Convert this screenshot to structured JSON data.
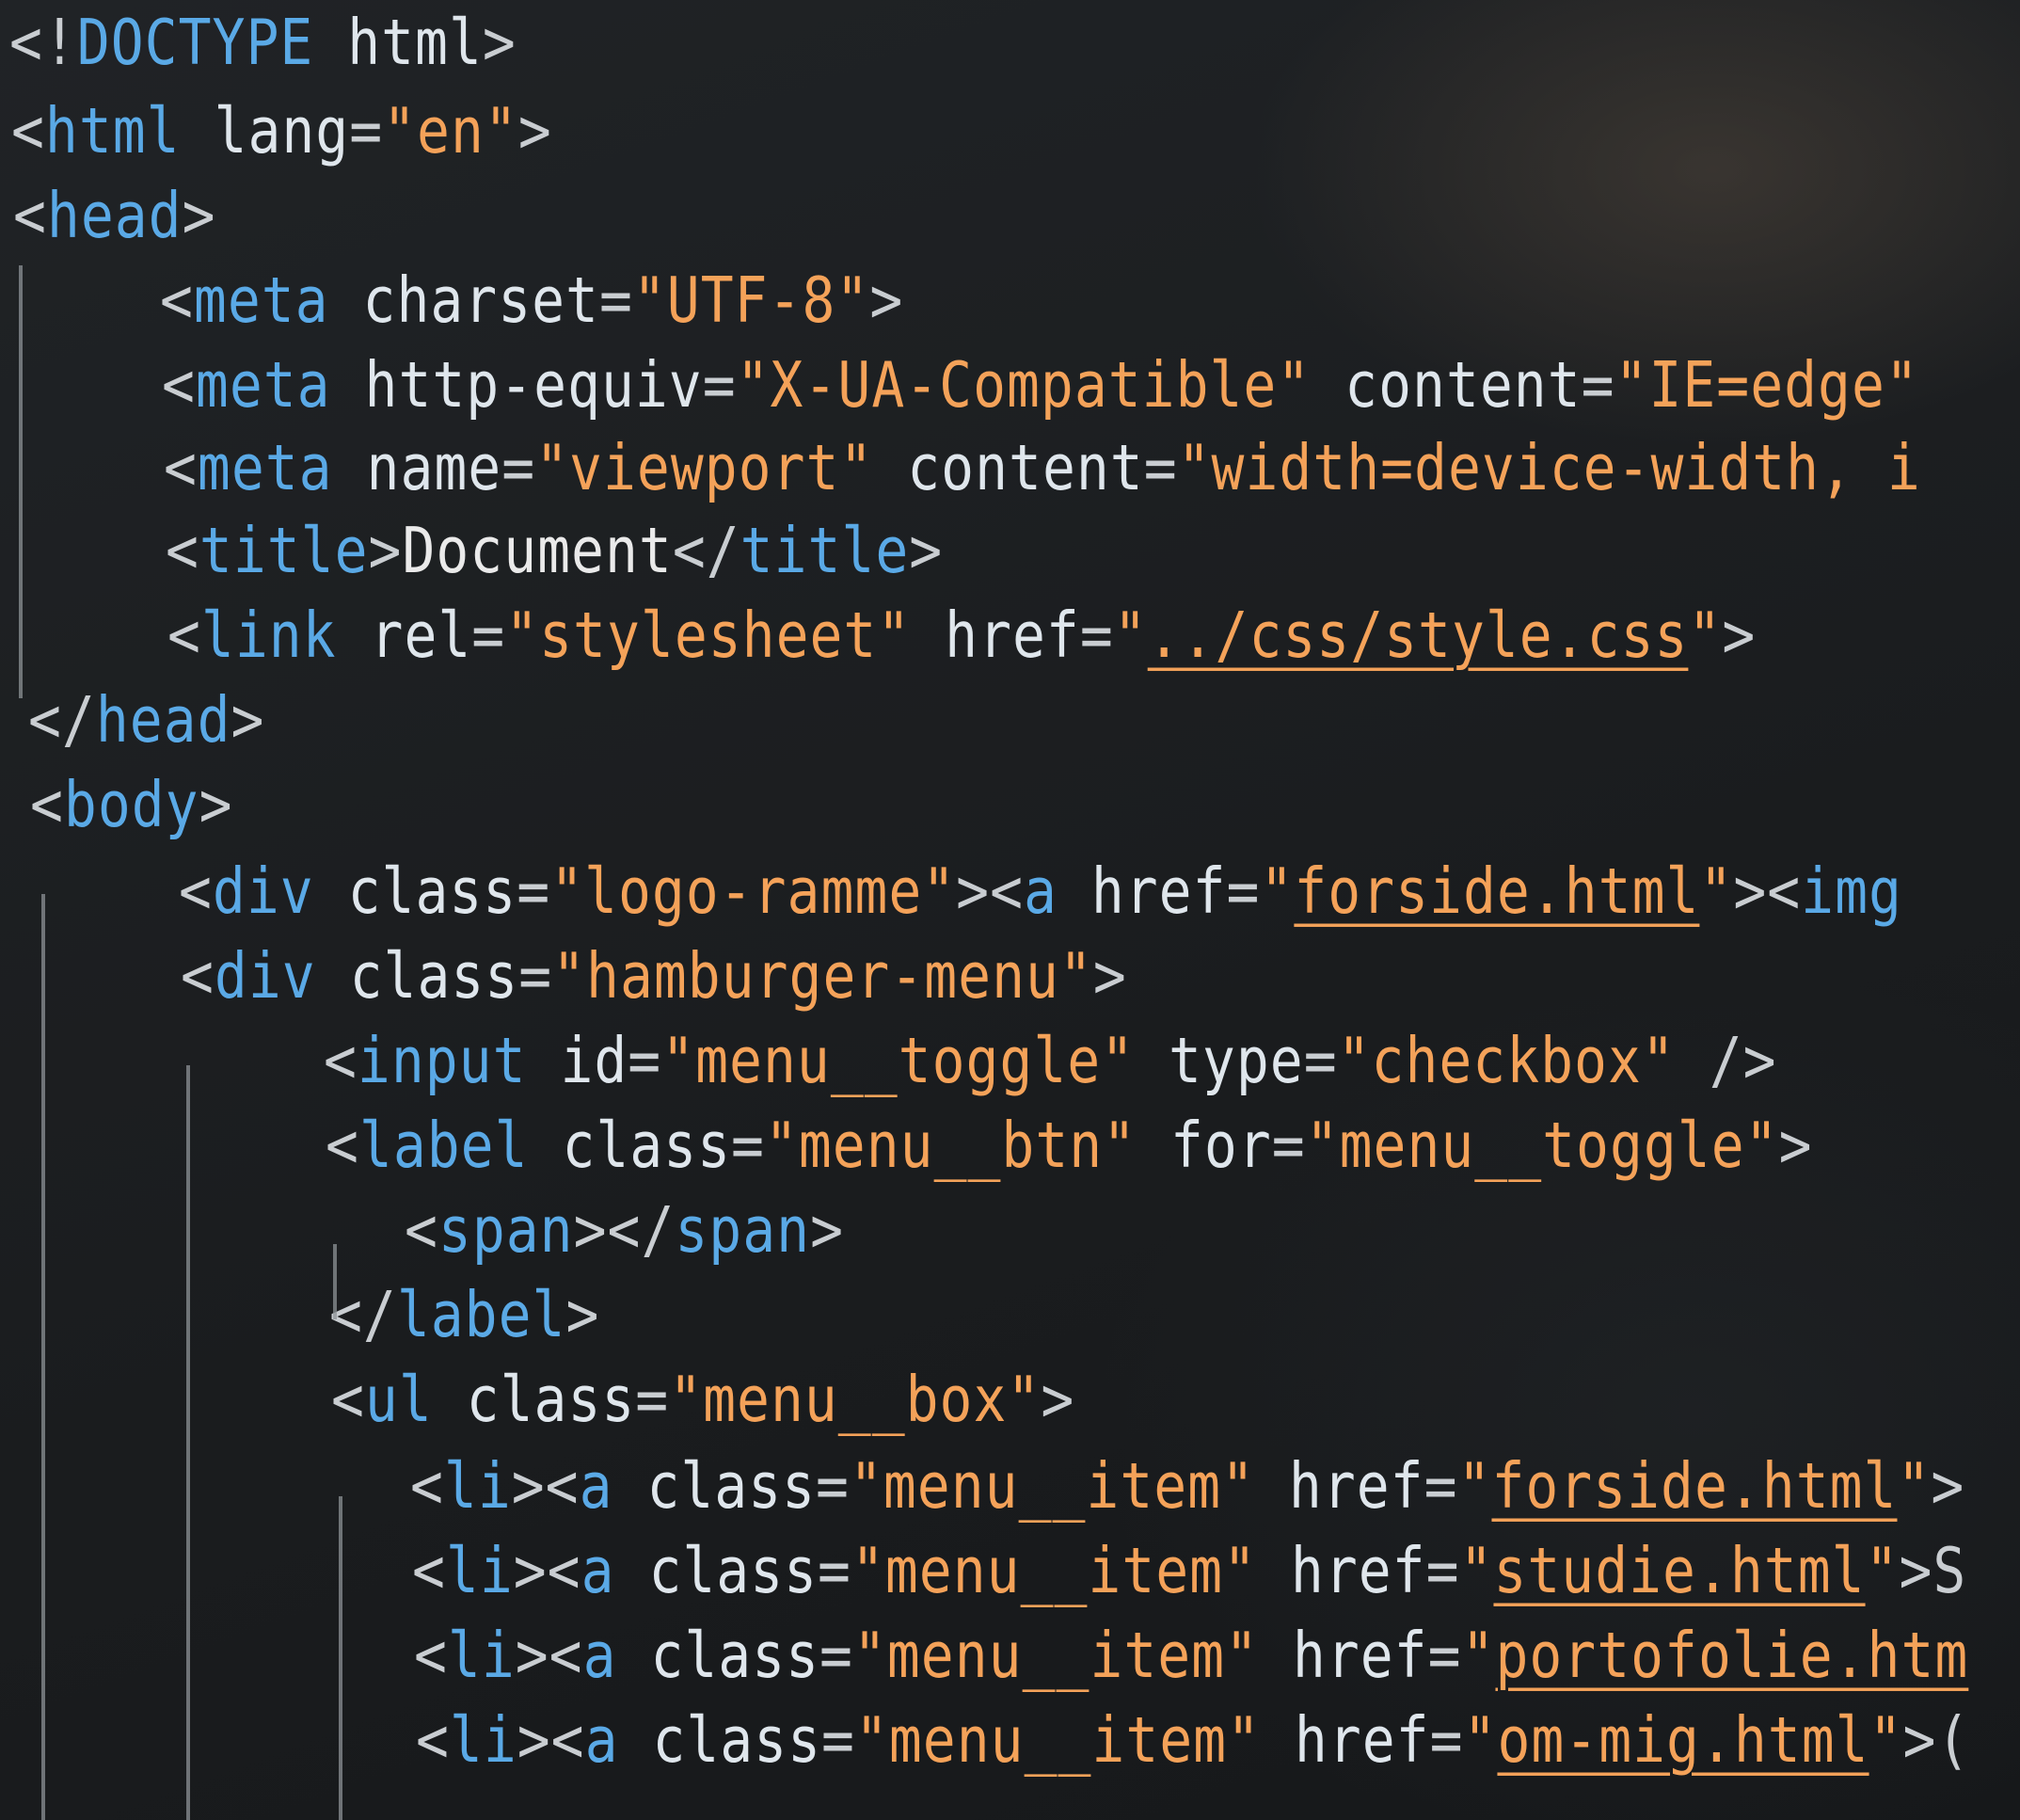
{
  "editor": {
    "lines": [
      [
        {
          "t": "<!",
          "c": "punct"
        },
        {
          "t": "DOCTYPE",
          "c": "doctype"
        },
        {
          "t": " html",
          "c": "attr"
        },
        {
          "t": ">",
          "c": "punct"
        }
      ],
      [
        {
          "t": "<",
          "c": "punct"
        },
        {
          "t": "html",
          "c": "tag"
        },
        {
          "t": " lang",
          "c": "attr"
        },
        {
          "t": "=",
          "c": "punct"
        },
        {
          "t": "\"en\"",
          "c": "str"
        },
        {
          "t": ">",
          "c": "punct"
        }
      ],
      [
        {
          "t": "<",
          "c": "punct"
        },
        {
          "t": "head",
          "c": "tag"
        },
        {
          "t": ">",
          "c": "punct"
        }
      ],
      [
        {
          "t": "<",
          "c": "punct"
        },
        {
          "t": "meta",
          "c": "tag"
        },
        {
          "t": " charset",
          "c": "attr"
        },
        {
          "t": "=",
          "c": "punct"
        },
        {
          "t": "\"UTF-8\"",
          "c": "str"
        },
        {
          "t": ">",
          "c": "punct"
        }
      ],
      [
        {
          "t": "<",
          "c": "punct"
        },
        {
          "t": "meta",
          "c": "tag"
        },
        {
          "t": " http-equiv",
          "c": "attr"
        },
        {
          "t": "=",
          "c": "punct"
        },
        {
          "t": "\"X-UA-Compatible\"",
          "c": "str"
        },
        {
          "t": " content",
          "c": "attr"
        },
        {
          "t": "=",
          "c": "punct"
        },
        {
          "t": "\"IE=edge\"",
          "c": "str"
        }
      ],
      [
        {
          "t": "<",
          "c": "punct"
        },
        {
          "t": "meta",
          "c": "tag"
        },
        {
          "t": " name",
          "c": "attr"
        },
        {
          "t": "=",
          "c": "punct"
        },
        {
          "t": "\"viewport\"",
          "c": "str"
        },
        {
          "t": " content",
          "c": "attr"
        },
        {
          "t": "=",
          "c": "punct"
        },
        {
          "t": "\"width=device-width, i",
          "c": "str"
        }
      ],
      [
        {
          "t": "<",
          "c": "punct"
        },
        {
          "t": "title",
          "c": "tag"
        },
        {
          "t": ">",
          "c": "punct"
        },
        {
          "t": "Document",
          "c": "txt"
        },
        {
          "t": "</",
          "c": "punct"
        },
        {
          "t": "title",
          "c": "tag"
        },
        {
          "t": ">",
          "c": "punct"
        }
      ],
      [
        {
          "t": "<",
          "c": "punct"
        },
        {
          "t": "link",
          "c": "tag"
        },
        {
          "t": " rel",
          "c": "attr"
        },
        {
          "t": "=",
          "c": "punct"
        },
        {
          "t": "\"stylesheet\"",
          "c": "str"
        },
        {
          "t": " href",
          "c": "attr"
        },
        {
          "t": "=",
          "c": "punct"
        },
        {
          "t": "\"",
          "c": "str"
        },
        {
          "t": "../css/style.css",
          "c": "link"
        },
        {
          "t": "\"",
          "c": "str"
        },
        {
          "t": ">",
          "c": "punct"
        }
      ],
      [
        {
          "t": "</",
          "c": "punct"
        },
        {
          "t": "head",
          "c": "tag"
        },
        {
          "t": ">",
          "c": "punct"
        }
      ],
      [
        {
          "t": "<",
          "c": "punct"
        },
        {
          "t": "body",
          "c": "tag"
        },
        {
          "t": ">",
          "c": "punct"
        }
      ],
      [
        {
          "t": "<",
          "c": "punct"
        },
        {
          "t": "div",
          "c": "tag"
        },
        {
          "t": " class",
          "c": "attr"
        },
        {
          "t": "=",
          "c": "punct"
        },
        {
          "t": "\"logo-ramme\"",
          "c": "str"
        },
        {
          "t": "><",
          "c": "punct"
        },
        {
          "t": "a",
          "c": "tag"
        },
        {
          "t": " href",
          "c": "attr"
        },
        {
          "t": "=",
          "c": "punct"
        },
        {
          "t": "\"",
          "c": "str"
        },
        {
          "t": "forside.html",
          "c": "link"
        },
        {
          "t": "\"",
          "c": "str"
        },
        {
          "t": "><",
          "c": "punct"
        },
        {
          "t": "img",
          "c": "tag"
        }
      ],
      [
        {
          "t": "<",
          "c": "punct"
        },
        {
          "t": "div",
          "c": "tag"
        },
        {
          "t": " class",
          "c": "attr"
        },
        {
          "t": "=",
          "c": "punct"
        },
        {
          "t": "\"hamburger-menu\"",
          "c": "str"
        },
        {
          "t": ">",
          "c": "punct"
        }
      ],
      [
        {
          "t": "<",
          "c": "punct"
        },
        {
          "t": "input",
          "c": "tag"
        },
        {
          "t": " id",
          "c": "attr"
        },
        {
          "t": "=",
          "c": "punct"
        },
        {
          "t": "\"menu__toggle\"",
          "c": "str"
        },
        {
          "t": " type",
          "c": "attr"
        },
        {
          "t": "=",
          "c": "punct"
        },
        {
          "t": "\"checkbox\"",
          "c": "str"
        },
        {
          "t": " />",
          "c": "punct"
        }
      ],
      [
        {
          "t": "<",
          "c": "punct"
        },
        {
          "t": "label",
          "c": "tag"
        },
        {
          "t": " class",
          "c": "attr"
        },
        {
          "t": "=",
          "c": "punct"
        },
        {
          "t": "\"menu__btn\"",
          "c": "str"
        },
        {
          "t": " for",
          "c": "attr"
        },
        {
          "t": "=",
          "c": "punct"
        },
        {
          "t": "\"menu__toggle\"",
          "c": "str"
        },
        {
          "t": ">",
          "c": "punct"
        }
      ],
      [
        {
          "t": "<",
          "c": "punct"
        },
        {
          "t": "span",
          "c": "tag"
        },
        {
          "t": "></",
          "c": "punct"
        },
        {
          "t": "span",
          "c": "tag"
        },
        {
          "t": ">",
          "c": "punct"
        }
      ],
      [
        {
          "t": "</",
          "c": "punct"
        },
        {
          "t": "label",
          "c": "tag"
        },
        {
          "t": ">",
          "c": "punct"
        }
      ],
      [
        {
          "t": "<",
          "c": "punct"
        },
        {
          "t": "ul",
          "c": "tag"
        },
        {
          "t": " class",
          "c": "attr"
        },
        {
          "t": "=",
          "c": "punct"
        },
        {
          "t": "\"menu__box\"",
          "c": "str"
        },
        {
          "t": ">",
          "c": "punct"
        }
      ],
      [
        {
          "t": "<",
          "c": "punct"
        },
        {
          "t": "li",
          "c": "tag"
        },
        {
          "t": "><",
          "c": "punct"
        },
        {
          "t": "a",
          "c": "tag"
        },
        {
          "t": " class",
          "c": "attr"
        },
        {
          "t": "=",
          "c": "punct"
        },
        {
          "t": "\"menu__item\"",
          "c": "str"
        },
        {
          "t": " href",
          "c": "attr"
        },
        {
          "t": "=",
          "c": "punct"
        },
        {
          "t": "\"",
          "c": "str"
        },
        {
          "t": "forside.html",
          "c": "link"
        },
        {
          "t": "\"",
          "c": "str"
        },
        {
          "t": ">",
          "c": "punct"
        }
      ],
      [
        {
          "t": "<",
          "c": "punct"
        },
        {
          "t": "li",
          "c": "tag"
        },
        {
          "t": "><",
          "c": "punct"
        },
        {
          "t": "a",
          "c": "tag"
        },
        {
          "t": " class",
          "c": "attr"
        },
        {
          "t": "=",
          "c": "punct"
        },
        {
          "t": "\"menu__item\"",
          "c": "str"
        },
        {
          "t": " href",
          "c": "attr"
        },
        {
          "t": "=",
          "c": "punct"
        },
        {
          "t": "\"",
          "c": "str"
        },
        {
          "t": "studie.html",
          "c": "link"
        },
        {
          "t": "\"",
          "c": "str"
        },
        {
          "t": ">S",
          "c": "punct"
        }
      ],
      [
        {
          "t": "<",
          "c": "punct"
        },
        {
          "t": "li",
          "c": "tag"
        },
        {
          "t": "><",
          "c": "punct"
        },
        {
          "t": "a",
          "c": "tag"
        },
        {
          "t": " class",
          "c": "attr"
        },
        {
          "t": "=",
          "c": "punct"
        },
        {
          "t": "\"menu__item\"",
          "c": "str"
        },
        {
          "t": " href",
          "c": "attr"
        },
        {
          "t": "=",
          "c": "punct"
        },
        {
          "t": "\"",
          "c": "str"
        },
        {
          "t": "portofolie.htm",
          "c": "link"
        }
      ],
      [
        {
          "t": "<",
          "c": "punct"
        },
        {
          "t": "li",
          "c": "tag"
        },
        {
          "t": "><",
          "c": "punct"
        },
        {
          "t": "a",
          "c": "tag"
        },
        {
          "t": " class",
          "c": "attr"
        },
        {
          "t": "=",
          "c": "punct"
        },
        {
          "t": "\"menu__item\"",
          "c": "str"
        },
        {
          "t": " href",
          "c": "attr"
        },
        {
          "t": "=",
          "c": "punct"
        },
        {
          "t": "\"",
          "c": "str"
        },
        {
          "t": "om-mig.html",
          "c": "link"
        },
        {
          "t": "\"",
          "c": "str"
        },
        {
          "t": ">(",
          "c": "punct"
        }
      ]
    ]
  }
}
